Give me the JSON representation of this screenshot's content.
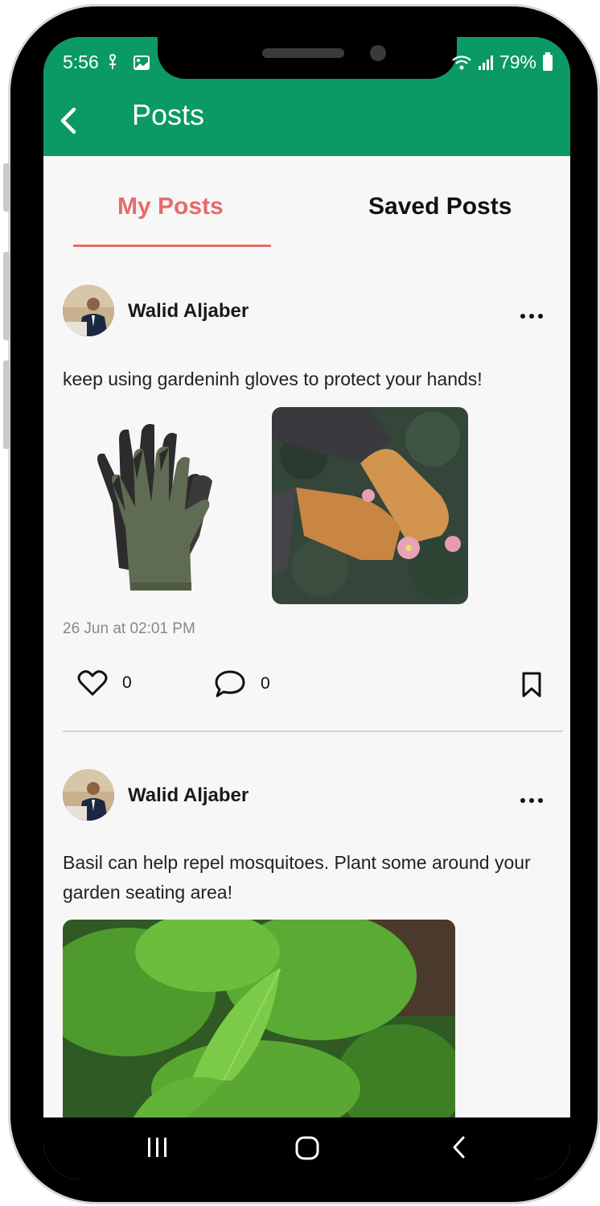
{
  "status_bar": {
    "time": "5:56",
    "battery": "79%"
  },
  "header": {
    "title": "Posts"
  },
  "tabs": [
    {
      "label": "My Posts",
      "active": true
    },
    {
      "label": "Saved Posts",
      "active": false
    }
  ],
  "posts": [
    {
      "author": "Walid Aljaber",
      "text": "keep using gardeninh gloves to protect your hands!",
      "timestamp": "26 Jun at 02:01 PM",
      "likes": "0",
      "comments": "0"
    },
    {
      "author": "Walid Aljaber",
      "text": "Basil can help repel mosquitoes. Plant some around your garden seating area!"
    }
  ],
  "colors": {
    "appbar": "#0b9a63",
    "active_tab": "#e86a6a"
  }
}
